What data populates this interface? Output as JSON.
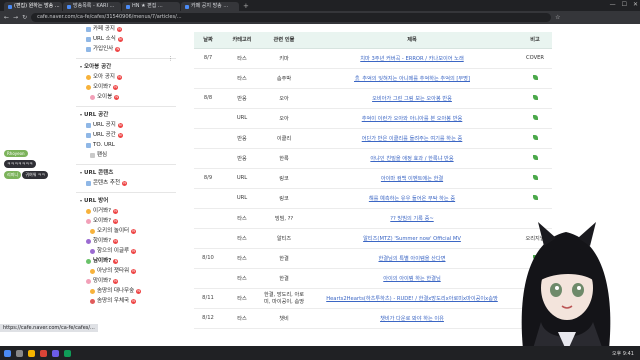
{
  "browser": {
    "tabs": [
      {
        "label": "(편집) 원하는 방송 ..."
      },
      {
        "label": "방송목록 - KARI ..."
      },
      {
        "label": "HN ★ 편집 ..."
      },
      {
        "label": "카페 공지 방송 ..."
      }
    ],
    "url": "cafe.naver.com/ca-fe/cafes/31540906/menus/7/articles/..."
  },
  "status_url": "https://cafe.naver.com/ca-fe/cafes/...",
  "sidebar": {
    "top_items": [
      {
        "label": "카페 공지",
        "badge": "N"
      },
      {
        "label": "URL 소식",
        "badge": "N"
      },
      {
        "label": "가입인사",
        "badge": "N"
      }
    ],
    "sections": [
      {
        "title": "오아봉 공간",
        "items": [
          {
            "label": "오아 공지",
            "badge": "N"
          },
          {
            "label": "오이봐?",
            "badge": "N"
          },
          {
            "label": "오이봉",
            "badge": "N"
          }
        ]
      },
      {
        "title": "URL 공간",
        "items": [
          {
            "label": "URL 공지",
            "badge": "N"
          },
          {
            "label": "URL 공간",
            "badge": "N"
          },
          {
            "label": "TO. URL",
            "badge": ""
          },
          {
            "label": "팬심",
            "badge": ""
          }
        ]
      },
      {
        "title": "URL 콘텐츠",
        "items": [
          {
            "label": "콘텐츠 추천",
            "badge": "N"
          }
        ]
      },
      {
        "title": "URL 방어",
        "items": [
          {
            "label": "이거봐?",
            "badge": "N"
          },
          {
            "label": "오이봐?",
            "badge": "N"
          },
          {
            "label": "오키의 놀이터",
            "badge": "N"
          },
          {
            "label": "항이봐?",
            "badge": "N"
          },
          {
            "label": "항으의 이글루",
            "badge": "N"
          },
          {
            "label": "남이봐?",
            "badge": "N"
          },
          {
            "label": "아냥의 잿타워",
            "badge": "N"
          },
          {
            "label": "망이봐?",
            "badge": "N"
          },
          {
            "label": "솜땅의 대나무숲",
            "badge": "N"
          },
          {
            "label": "솜땅의 우체국",
            "badge": "N"
          }
        ]
      }
    ]
  },
  "side_badges": {
    "b1": "Rhoyeon",
    "b2": "ㅋㅋㅋㅋㅋㅋㅋ",
    "b3": "리피니",
    "b4": "귀여워 ㅋㅋ"
  },
  "table": {
    "headers": [
      "날짜",
      "카테고리",
      "관련 인물",
      "제목",
      "비고"
    ],
    "rows": [
      {
        "date": "8/7",
        "category": "타스",
        "person": "키마",
        "title": "치마 3주년 커버곡 - ERROR / 카나모이어 노래",
        "note": "COVER"
      },
      {
        "date": "",
        "category": "타스",
        "person": "솜주박",
        "title": "🎗 추억의 잊혀지는 아니메를 추억하는 추억의 [무명]",
        "note": "leaf"
      },
      {
        "date": "8/8",
        "category": "반응",
        "person": "오아",
        "title": "오비아가 그린 그림 보는 오아봉 반응",
        "note": "leaf"
      },
      {
        "date": "",
        "category": "URL",
        "person": "오아",
        "title": "추억이 이런가 오아와 아니아를 본 오아봉 반응",
        "note": "leaf"
      },
      {
        "date": "",
        "category": "반응",
        "person": "이클리",
        "title": "어딘가 반은 이클리를 들려주는 여기를 하는 중",
        "note": "leaf"
      },
      {
        "date": "",
        "category": "반응",
        "person": "한록",
        "title": "아냐인 친밀을 애정 효과 / 한록냐 반응",
        "note": "leaf"
      },
      {
        "date": "8/9",
        "category": "URL",
        "person": "링코",
        "title": "아이마 컴백 이벤트에는 한결",
        "note": "leaf"
      },
      {
        "date": "",
        "category": "URL",
        "person": "링코",
        "title": "해를 예측하는 유우 들어온 부탁 하는 중",
        "note": "leaf"
      },
      {
        "date": "",
        "category": "타스",
        "person": "빙빔, ??",
        "title": "?? 빙빔의 기록 중~",
        "note": ""
      },
      {
        "date": "",
        "category": "타스",
        "person": "알티즈",
        "title": "알티즈(MTZ) 'Summer now' Official MV",
        "note": "오리지널"
      },
      {
        "date": "8/10",
        "category": "타스",
        "person": "한결",
        "title": "한결님의 특별 아이템을 산다면",
        "note": "leaf"
      },
      {
        "date": "",
        "category": "타스",
        "person": "한결",
        "title": "아이의 아이템 하는 한결님",
        "note": "leaf"
      },
      {
        "date": "8/11",
        "category": "타스",
        "person": "한결, 망도리, 아로미, 마이공이, 솜땅",
        "title": "Hearts2Hearts(하츠투하츠) - RUDE! / 한결x망도리x아로미x마이공이x솜땅",
        "note": "leaf"
      },
      {
        "date": "8/12",
        "category": "타스",
        "person": "챗비",
        "title": "챗비가 다운로 봐야 하는 이유",
        "note": "leaf"
      }
    ]
  },
  "taskbar": {
    "clock": "오후 9:41"
  }
}
